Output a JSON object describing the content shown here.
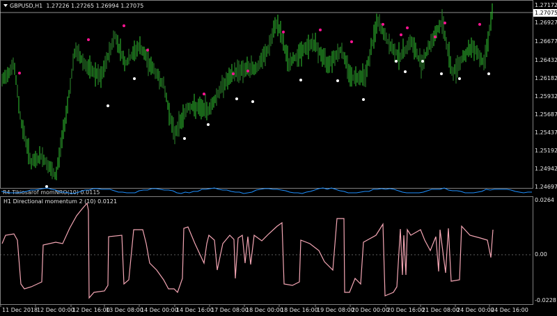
{
  "main_chart": {
    "symbol_label": "GBPUSD,H1",
    "ohlc_label": "1.27226 1.27265 1.26994 1.27075",
    "current_price": "1.27075",
    "price_levels": [
      "1.27172",
      "1.26927",
      "1.26677",
      "1.26432",
      "1.26182",
      "1.25932",
      "1.25687",
      "1.25437",
      "1.25192",
      "1.24942",
      "1.24697"
    ]
  },
  "sub_indicator": {
    "title": "H1 Directional momentum 2 (10) 0.0121",
    "levels": [
      "0.0264",
      "0.00",
      "-0.0228"
    ]
  },
  "overlap_title": "R4 Tikiosarof momNRO(10) 0.0115",
  "time_axis": [
    "11 Dec 2018",
    "12 Dec 00:00",
    "12 Dec 16:00",
    "13 Dec 08:00",
    "14 Dec 00:00",
    "14 Dec 16:00",
    "17 Dec 08:00",
    "18 Dec 00:00",
    "18 Dec 16:00",
    "19 Dec 08:00",
    "20 Dec 00:00",
    "20 Dec 16:00",
    "21 Dec 08:00",
    "24 Dec 00:00",
    "24 Dec 16:00"
  ],
  "colors": {
    "bull": "#32cd32",
    "bear": "#2e8b2e",
    "upper_dot": "#ff1493",
    "lower_dot": "#ffffff",
    "momentum": "#f4a6b4",
    "mid_osc": "#1e90ff"
  },
  "chart_data": {
    "type": "line",
    "title": "GBPUSD,H1",
    "x": [
      "11 Dec 2018",
      "12 Dec 00:00",
      "12 Dec 16:00",
      "13 Dec 08:00",
      "14 Dec 00:00",
      "14 Dec 16:00",
      "17 Dec 08:00",
      "18 Dec 00:00",
      "18 Dec 16:00",
      "19 Dec 08:00",
      "20 Dec 00:00",
      "20 Dec 16:00",
      "21 Dec 08:00",
      "24 Dec 00:00",
      "24 Dec 16:00"
    ],
    "series": [
      {
        "name": "GBPUSD,H1",
        "values": [
          1.2615,
          1.2502,
          1.2655,
          1.265,
          1.263,
          1.2585,
          1.2612,
          1.2625,
          1.2655,
          1.264,
          1.262,
          1.266,
          1.2645,
          1.264,
          1.271
        ]
      },
      {
        "name": "H1 Directional momentum 2 (10)",
        "values": [
          0.012,
          0.015,
          0.024,
          0.01,
          -0.012,
          0.008,
          -0.015,
          0.009,
          0.014,
          -0.01,
          0.011,
          0.013,
          -0.011,
          -0.012,
          0.0121
        ]
      }
    ],
    "ylim": [
      1.2465,
      1.2722
    ]
  }
}
